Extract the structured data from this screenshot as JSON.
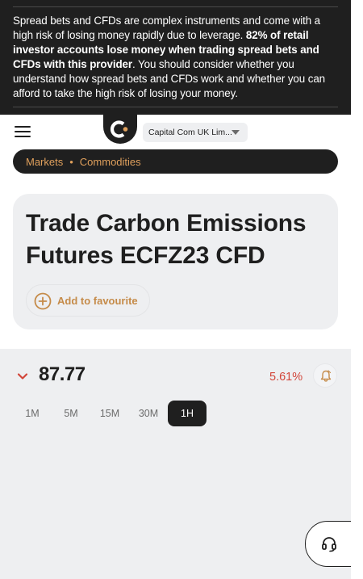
{
  "risk_warning": {
    "part1": "Spread bets and CFDs are complex instruments and come with a high risk of losing money rapidly due to leverage. ",
    "bold": "82% of retail investor accounts lose money when trading spread bets and CFDs with this provider",
    "part2": ". You should consider whether you understand how spread bets and CFDs work and whether you can afford to take the high risk of losing your money."
  },
  "header": {
    "menu_icon": "hamburger-icon",
    "logo_icon": "capital-com-logo",
    "entity_selector": "Capital Com UK Lim..."
  },
  "breadcrumb": {
    "items": [
      "Markets",
      "Commodities"
    ],
    "separator": "•"
  },
  "instrument": {
    "title": "Trade Carbon Emissions Futures ECFZ23 CFD",
    "favourite_label": "Add to favourite"
  },
  "quote": {
    "price": "87.77",
    "change": "5.61%",
    "direction": "down",
    "change_color": "#d2463a"
  },
  "timeframes": {
    "items": [
      "1M",
      "5M",
      "15M",
      "30M",
      "1H"
    ],
    "selected": "1H"
  },
  "support": {
    "icon": "headset-icon"
  },
  "colors": {
    "accent": "#c58b49",
    "breadcrumb_text": "#e0a05c",
    "dark": "#1f1f1f",
    "panel": "#eeeff1"
  }
}
